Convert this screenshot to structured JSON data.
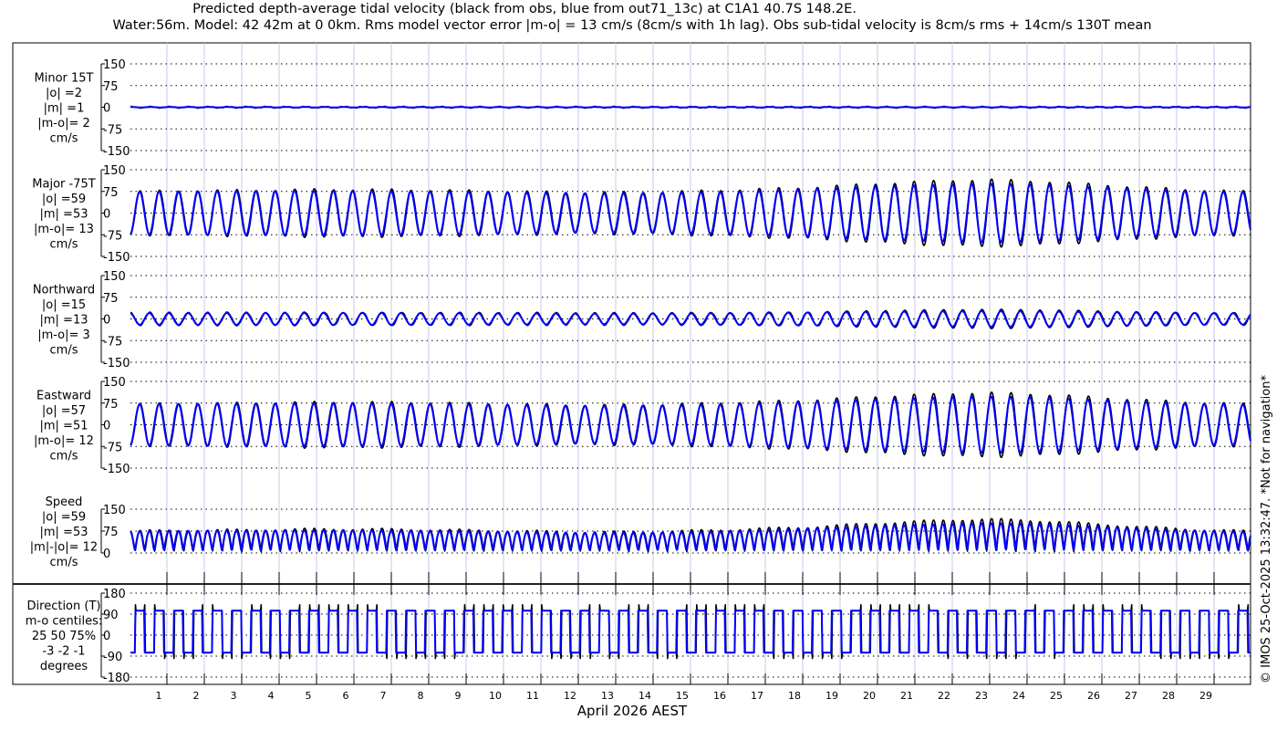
{
  "chart_data": {
    "type": "line",
    "title": "Predicted depth-average tidal velocity (black from obs, blue from out71_13c) at C1A1  40.7S 148.2E.",
    "subtitle": "Water:56m. Model: 42 42m at 0 0km. Rms model vector error |m-o| = 13 cm/s (8cm/s with 1h lag). Obs sub-tidal velocity is 8cm/s rms + 14cm/s 130T mean",
    "xlabel": "April 2026 AEST",
    "xticks": [
      "1",
      "2",
      "3",
      "4",
      "5",
      "6",
      "7",
      "8",
      "9",
      "10",
      "11",
      "12",
      "13",
      "14",
      "15",
      "16",
      "17",
      "18",
      "19",
      "20",
      "21",
      "22",
      "23",
      "24",
      "25",
      "26",
      "27",
      "28",
      "29"
    ],
    "xlim_days": [
      0.02,
      29.98
    ],
    "grid": true,
    "colors": {
      "obs": "#000000",
      "model": "#0000ff",
      "day_grid": "#c8c8ee"
    },
    "series_legend": {
      "obs": "black from obs",
      "model": "blue from out71_13c"
    },
    "envelope_days": [
      0,
      1,
      2,
      3,
      4,
      5,
      6,
      7,
      8,
      9,
      10,
      11,
      12,
      13,
      14,
      15,
      16,
      17,
      18,
      19,
      20,
      21,
      22,
      23,
      24,
      25,
      26,
      27,
      28,
      29,
      30
    ],
    "major_envelope_obs": [
      75,
      77,
      78,
      79,
      80,
      82,
      82,
      81,
      80,
      78,
      76,
      74,
      72,
      72,
      73,
      76,
      80,
      84,
      88,
      95,
      102,
      108,
      113,
      116,
      112,
      106,
      98,
      90,
      84,
      78,
      75
    ],
    "major_envelope_model": [
      74,
      75,
      76,
      76,
      77,
      77,
      77,
      76,
      75,
      74,
      72,
      70,
      68,
      68,
      69,
      71,
      74,
      78,
      82,
      87,
      92,
      96,
      100,
      102,
      100,
      95,
      89,
      83,
      78,
      74,
      72
    ],
    "panels": [
      {
        "id": "minor",
        "label": [
          "Minor 15T",
          "|o| =2",
          "|m| =1",
          "|m-o|= 2",
          "cm/s"
        ],
        "yticks": [
          "150",
          "75",
          "0",
          "-75",
          "-150"
        ],
        "ylim": [
          -150,
          150
        ]
      },
      {
        "id": "major",
        "label": [
          "Major -75T",
          "|o| =59",
          "|m| =53",
          "|m-o|= 13",
          "cm/s"
        ],
        "yticks": [
          "150",
          "75",
          "0",
          "-75",
          "-150"
        ],
        "ylim": [
          -150,
          150
        ]
      },
      {
        "id": "north",
        "label": [
          "Northward",
          "|o| =15",
          "|m| =13",
          "|m-o|= 3",
          "cm/s"
        ],
        "yticks": [
          "150",
          "75",
          "0",
          "-75",
          "-150"
        ],
        "ylim": [
          -150,
          150
        ]
      },
      {
        "id": "east",
        "label": [
          "Eastward",
          "|o| =57",
          "|m| =51",
          "|m-o|= 12",
          "cm/s"
        ],
        "yticks": [
          "150",
          "75",
          "0",
          "-75",
          "-150"
        ],
        "ylim": [
          -150,
          150
        ]
      },
      {
        "id": "speed",
        "label": [
          "Speed",
          "|o| =59",
          "|m| =53",
          "|m|-|o|= 12",
          "cm/s"
        ],
        "yticks": [
          "150",
          "75",
          "0"
        ],
        "ylim": [
          0,
          150
        ]
      },
      {
        "id": "direction",
        "label": [
          "Direction (T)",
          "m-o centiles:",
          "25  50  75%",
          "-3 -2 -1",
          "degrees"
        ],
        "yticks": [
          "180",
          "90",
          "0",
          "-90",
          "-180"
        ],
        "ylim": [
          -180,
          180
        ]
      }
    ],
    "direction_values": {
      "flood": 105,
      "ebb": -75
    },
    "watermark": "© IMOS 25-Oct-2025 13:32:47. *Not for navigation*"
  }
}
